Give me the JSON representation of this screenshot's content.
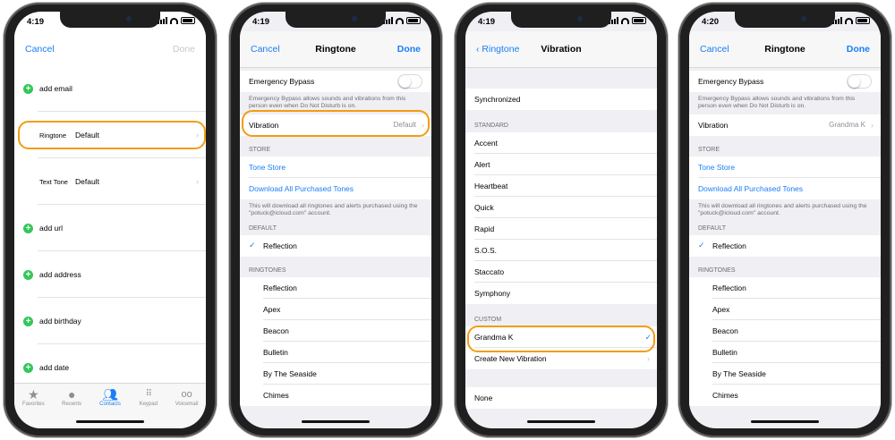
{
  "colors": {
    "accent": "#1a7ef6",
    "highlight": "#f39c12",
    "check": "#1a7ef6"
  },
  "phone1": {
    "time": "4:19",
    "nav": {
      "left": "Cancel",
      "right": "Done"
    },
    "rows": [
      {
        "type": "add",
        "label": "add email"
      },
      {
        "type": "field",
        "label": "Ringtone",
        "value": "Default"
      },
      {
        "type": "field",
        "label": "Text Tone",
        "value": "Default"
      },
      {
        "type": "add",
        "label": "add url"
      },
      {
        "type": "add",
        "label": "add address"
      },
      {
        "type": "add",
        "label": "add birthday"
      },
      {
        "type": "add",
        "label": "add date"
      }
    ],
    "tabs": [
      {
        "label": "Favorites",
        "icon": "star-icon"
      },
      {
        "label": "Recents",
        "icon": "clock-icon"
      },
      {
        "label": "Contacts",
        "icon": "contacts-icon",
        "active": true
      },
      {
        "label": "Keypad",
        "icon": "keypad-icon"
      },
      {
        "label": "Voicemail",
        "icon": "voicemail-icon"
      }
    ]
  },
  "phone2": {
    "time": "4:19",
    "nav": {
      "left": "Cancel",
      "title": "Ringtone",
      "right": "Done"
    },
    "emergency_label": "Emergency Bypass",
    "emergency_note": "Emergency Bypass allows sounds and vibrations from this person even when Do Not Disturb is on.",
    "vibration_label": "Vibration",
    "vibration_value": "Default",
    "store_header": "STORE",
    "tone_store": "Tone Store",
    "download_all": "Download All Purchased Tones",
    "download_note": "This will download all ringtones and alerts purchased using the \"potuck@icloud.com\" account.",
    "default_header": "DEFAULT",
    "default_item": "Reflection",
    "ringtones_header": "RINGTONES",
    "ringtones": [
      "Reflection",
      "Apex",
      "Beacon",
      "Bulletin",
      "By The Seaside",
      "Chimes"
    ]
  },
  "phone3": {
    "time": "4:19",
    "nav": {
      "back": "Ringtone",
      "title": "Vibration"
    },
    "synchronized": "Synchronized",
    "standard_header": "STANDARD",
    "standard": [
      "Accent",
      "Alert",
      "Heartbeat",
      "Quick",
      "Rapid",
      "S.O.S.",
      "Staccato",
      "Symphony"
    ],
    "custom_header": "CUSTOM",
    "custom_item": "Grandma K",
    "create_new": "Create New Vibration",
    "none": "None"
  },
  "phone4": {
    "time": "4:20",
    "nav": {
      "left": "Cancel",
      "title": "Ringtone",
      "right": "Done"
    },
    "emergency_label": "Emergency Bypass",
    "emergency_note": "Emergency Bypass allows sounds and vibrations from this person even when Do Not Disturb is on.",
    "vibration_label": "Vibration",
    "vibration_value": "Grandma K",
    "store_header": "STORE",
    "tone_store": "Tone Store",
    "download_all": "Download All Purchased Tones",
    "download_note": "This will download all ringtones and alerts purchased using the \"potuck@icloud.com\" account.",
    "default_header": "DEFAULT",
    "default_item": "Reflection",
    "ringtones_header": "RINGTONES",
    "ringtones": [
      "Reflection",
      "Apex",
      "Beacon",
      "Bulletin",
      "By The Seaside",
      "Chimes"
    ]
  }
}
